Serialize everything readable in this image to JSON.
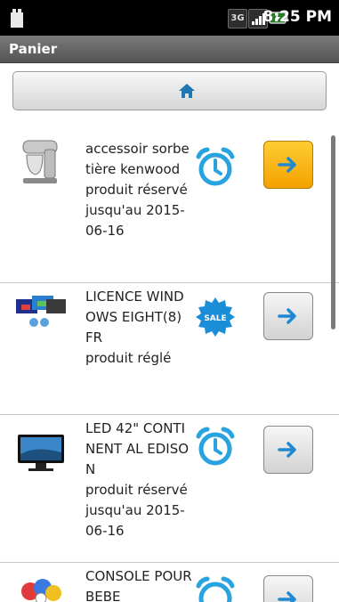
{
  "status_bar": {
    "time": "8:25 PM",
    "network": "3G"
  },
  "title_bar": {
    "title": "Panier"
  },
  "home_button": {
    "icon": "home-icon"
  },
  "items": [
    {
      "name": "accessoir sorbetière kenwood",
      "status": "produit réservé jusqu'au 2015-06-16",
      "thumbnail": "kitchen-mixer-image",
      "status_icon": "alarm-clock-icon",
      "action_icon": "arrow-right-icon",
      "highlighted": true
    },
    {
      "name": "LICENCE WINDOWS EIGHT(8) FR",
      "status": "produit réglé",
      "thumbnail": "software-box-image",
      "status_icon": "sale-badge-icon",
      "badge_text": "SALE",
      "action_icon": "arrow-right-icon",
      "highlighted": false
    },
    {
      "name": "LED 42\" CONTINENT AL EDISON",
      "status": "produit réservé jusqu'au 2015-06-16",
      "thumbnail": "tv-image",
      "status_icon": "alarm-clock-icon",
      "action_icon": "arrow-right-icon",
      "highlighted": false
    },
    {
      "name": "CONSOLE POUR BEBE",
      "status": "",
      "thumbnail": "baby-console-image",
      "status_icon": "alarm-clock-icon",
      "action_icon": "arrow-right-icon",
      "highlighted": false
    }
  ],
  "colors": {
    "accent_blue": "#29a3e0",
    "highlight_orange": "#f3a200",
    "title_bar": "#5f5f5f"
  }
}
